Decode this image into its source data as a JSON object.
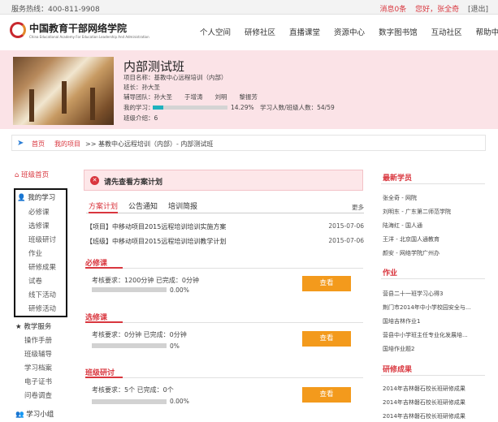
{
  "topbar": {
    "hotline": "服务热线：400-811-9908",
    "messages": "消息0条",
    "greeting": "您好，张全奇",
    "logout": "[退出]"
  },
  "logo": {
    "cn": "中国教育干部网络学院",
    "en": "China Educational Academy For Education Leadership And Administration"
  },
  "nav": [
    "个人空间",
    "研修社区",
    "直播课堂",
    "资源中心",
    "数字图书馆",
    "互动社区",
    "帮助中心"
  ],
  "banner": {
    "title": "内部测试班",
    "project": "项目名称：基教中心远程培训（内部）",
    "head": "班长：孙大圣",
    "team": "辅导团队：孙大圣　　于增涛　　刘明　　黎振芳",
    "my_study_label": "我的学习：",
    "progress": 14.29,
    "progress_text": "14.29%　学习人数/班级人数：54/59",
    "intro": "班级介绍：6"
  },
  "breadcrumb": {
    "home": "首页",
    "project": "我的项目",
    "trail": ">>  基教中心远程培训（内部）- 内部测试班"
  },
  "sidebar": {
    "home": "班级首页",
    "my_study": "我的学习",
    "study_items": [
      "必修课",
      "选修课",
      "班级研讨",
      "作业",
      "研修成果",
      "试卷",
      "线下活动",
      "研修活动"
    ],
    "teaching": "教学服务",
    "teach_items": [
      "操作手册",
      "班级辅导",
      "学习档案",
      "电子证书",
      "问卷调查"
    ],
    "group": "学习小组"
  },
  "main": {
    "alert": "请先查看方案计划",
    "tabs": [
      "方案计划",
      "公告通知",
      "培训简报"
    ],
    "more": "更多",
    "news": [
      {
        "title": "【项目】中移动项目2015远程培训培训实施方案",
        "date": "2015-07-06"
      },
      {
        "title": "【班级】中移动项目2015远程培训培训教学计划",
        "date": "2015-07-06"
      }
    ],
    "sections": [
      {
        "title": "必修课",
        "req": "考核要求：1200分钟 已完成：0分钟",
        "pct": "0.00%",
        "progress": 0,
        "button": "查看"
      },
      {
        "title": "选修课",
        "req": "考核要求：0分钟 已完成：0分钟",
        "pct": "0%",
        "progress": 0,
        "button": "查看"
      },
      {
        "title": "班级研讨",
        "req": "考核要求：5个 已完成：0个",
        "pct": "0.00%",
        "progress": 0,
        "button": "查看"
      }
    ]
  },
  "right": {
    "new_students_title": "最新学员",
    "new_students": [
      "张全奇 - 网院",
      "刘明东 - 广东第二师范学院",
      "陆海红 - 国人通",
      "王洋 - 北京国人通教育",
      "颜安 - 网络学院广州办"
    ],
    "homework_title": "作业",
    "homework": [
      "营县二十一班学习心得3",
      "荆门市2014年中小学校园安全与...",
      "国培吉林作业1",
      "营县中小学班主任专业化发展培...",
      "国培作业题2"
    ],
    "results_title": "研修成果",
    "results": [
      "2014年吉林磐石校长班研修成果",
      "2014年吉林磐石校长班研修成果",
      "2014年吉林磐石校长班研修成果"
    ]
  }
}
